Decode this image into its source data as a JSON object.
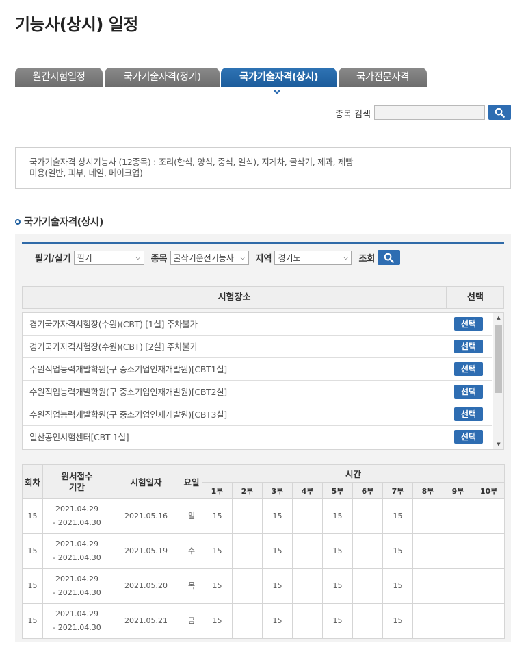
{
  "page": {
    "title": "기능사(상시) 일정"
  },
  "tabs": [
    {
      "label": "월간시험일정",
      "active": false
    },
    {
      "label": "국가기술자격(정기)",
      "active": false
    },
    {
      "label": "국가기술자격(상시)",
      "active": true
    },
    {
      "label": "국가전문자격",
      "active": false
    }
  ],
  "search": {
    "label": "종목 검색",
    "value": ""
  },
  "info": {
    "line1": "국가기술자격 상시기능사 (12종목) : 조리(한식, 양식, 중식, 일식), 지게차, 굴삭기, 제과, 제빵",
    "line2": "미용(일반, 피부, 네일, 메이크업)"
  },
  "section": {
    "title": "국가기술자격(상시)"
  },
  "filters": {
    "type_label": "필기/실기",
    "type_value": "필기",
    "item_label": "종목",
    "item_value": "굴삭기운전기능사",
    "region_label": "지역",
    "region_value": "경기도",
    "query_label": "조회"
  },
  "venues": {
    "header_place": "시험장소",
    "header_select": "선택",
    "select_label": "선택",
    "rows": [
      "경기국가자격시험장(수원)(CBT) [1실] 주차불가",
      "경기국가자격시험장(수원)(CBT) [2실] 주차불가",
      "수원직업능력개발학원(구 중소기업인재개발원)[CBT1실]",
      "수원직업능력개발학원(구 중소기업인재개발원)[CBT2실]",
      "수원직업능력개발학원(구 중소기업인재개발원)[CBT3실]",
      "일산공인시험센터[CBT 1실]"
    ]
  },
  "schedule": {
    "headers": {
      "round": "회차",
      "apply_1": "원서접수",
      "apply_2": "기간",
      "date": "시험일자",
      "weekday": "요일",
      "time": "시간"
    },
    "periods": [
      "1부",
      "2부",
      "3부",
      "4부",
      "5부",
      "6부",
      "7부",
      "8부",
      "9부",
      "10부"
    ],
    "rows": [
      {
        "round": "15",
        "apply_start": "2021.04.29",
        "apply_end": "- 2021.04.30",
        "date": "2021.05.16",
        "weekday": "일",
        "slots": [
          "15",
          "",
          "15",
          "",
          "15",
          "",
          "15",
          "",
          "",
          ""
        ]
      },
      {
        "round": "15",
        "apply_start": "2021.04.29",
        "apply_end": "- 2021.04.30",
        "date": "2021.05.19",
        "weekday": "수",
        "slots": [
          "15",
          "",
          "15",
          "",
          "15",
          "",
          "15",
          "",
          "",
          ""
        ]
      },
      {
        "round": "15",
        "apply_start": "2021.04.29",
        "apply_end": "- 2021.04.30",
        "date": "2021.05.20",
        "weekday": "목",
        "slots": [
          "15",
          "",
          "15",
          "",
          "15",
          "",
          "15",
          "",
          "",
          ""
        ]
      },
      {
        "round": "15",
        "apply_start": "2021.04.29",
        "apply_end": "- 2021.04.30",
        "date": "2021.05.21",
        "weekday": "금",
        "slots": [
          "15",
          "",
          "15",
          "",
          "15",
          "",
          "15",
          "",
          "",
          ""
        ]
      }
    ]
  },
  "colors": {
    "accent": "#2e6db2",
    "tab_inactive": "#7a7a7a",
    "header_bg": "#efefef"
  }
}
